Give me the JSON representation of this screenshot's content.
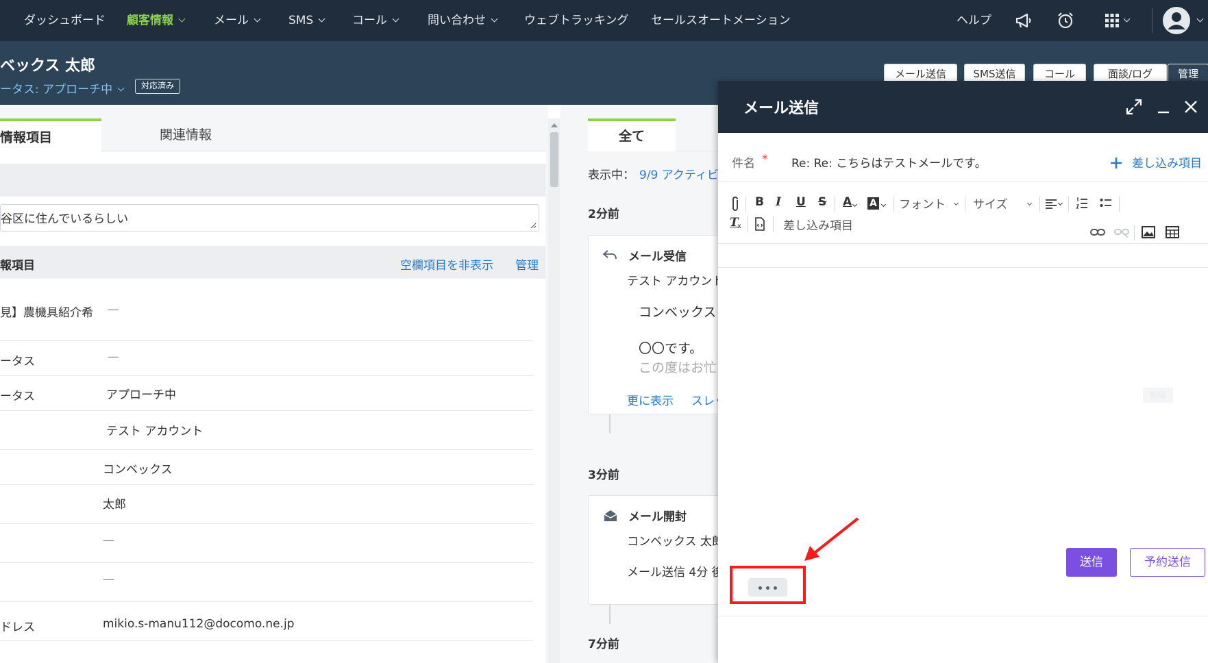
{
  "nav": {
    "items": [
      "ダッシュボード",
      "顧客情報",
      "メール",
      "SMS",
      "コール",
      "問い合わせ",
      "ウェブトラッキング",
      "セールスオートメーション"
    ],
    "help": "ヘルプ"
  },
  "record": {
    "name": "ベックス 太郎",
    "status": "ータス: アプローチ中",
    "badge": "対応済み",
    "buttons": [
      "メール送信",
      "SMS送信",
      "コール",
      "面談/ログ",
      "管理"
    ]
  },
  "left": {
    "tab_active": "情報項目",
    "tab_other": "関連情報",
    "memo": "谷区に住んでいるらしい",
    "section_title": "報項目",
    "hide_empty": "空欄項目を非表示",
    "manage": "管理",
    "rows": [
      {
        "k": "見】農機具紹介希",
        "v": "—"
      },
      {
        "k": "ータス",
        "v": "—"
      },
      {
        "k": "ータス",
        "v": "アプローチ中"
      },
      {
        "k": "",
        "v": "テスト アカウント"
      },
      {
        "k": "",
        "v": "コンベックス"
      },
      {
        "k": "",
        "v": "太郎"
      },
      {
        "k": "",
        "v": "—"
      },
      {
        "k": "",
        "v": "—"
      },
      {
        "k": "ドレス",
        "v": "mikio.s-manu112@docomo.ne.jp"
      }
    ]
  },
  "mid": {
    "tab": "全て",
    "showing_label": "表示中：",
    "showing_value": "9/9 アクティビ",
    "t1": "2分前",
    "card1_title": "メール受信",
    "card1_from": "テスト アカウント",
    "card1_body1": "コンベックス",
    "card1_body2": "〇〇です。",
    "card1_body3": "この度はお忙",
    "card1_more": "更に表示",
    "card1_thread": "スレッ",
    "t2": "3分前",
    "card2_title": "メール開封",
    "card2_l1": "コンベックス 太郎",
    "card2_l2": "メール送信 4分 後",
    "t3": "7分前"
  },
  "compose": {
    "title": "メール送信",
    "subject_label": "件名",
    "required_mark": "*",
    "subject_value": "Re: Re: こちらはテストメールです。",
    "merge_fields": "差し込み項目",
    "font": "フォント",
    "size": "サイズ",
    "merge_fields_toolbar": "差し込み項目",
    "send": "送信",
    "schedule": "予約送信",
    "faded_label": "削除"
  },
  "colors": {
    "nav_bg": "#1f2d3d",
    "header_bg": "#2d4458",
    "accent_green": "#8cd04b",
    "link_blue": "#2a7bc7",
    "send_purple": "#7b4fe0",
    "highlight_red": "#ff1a1a"
  }
}
